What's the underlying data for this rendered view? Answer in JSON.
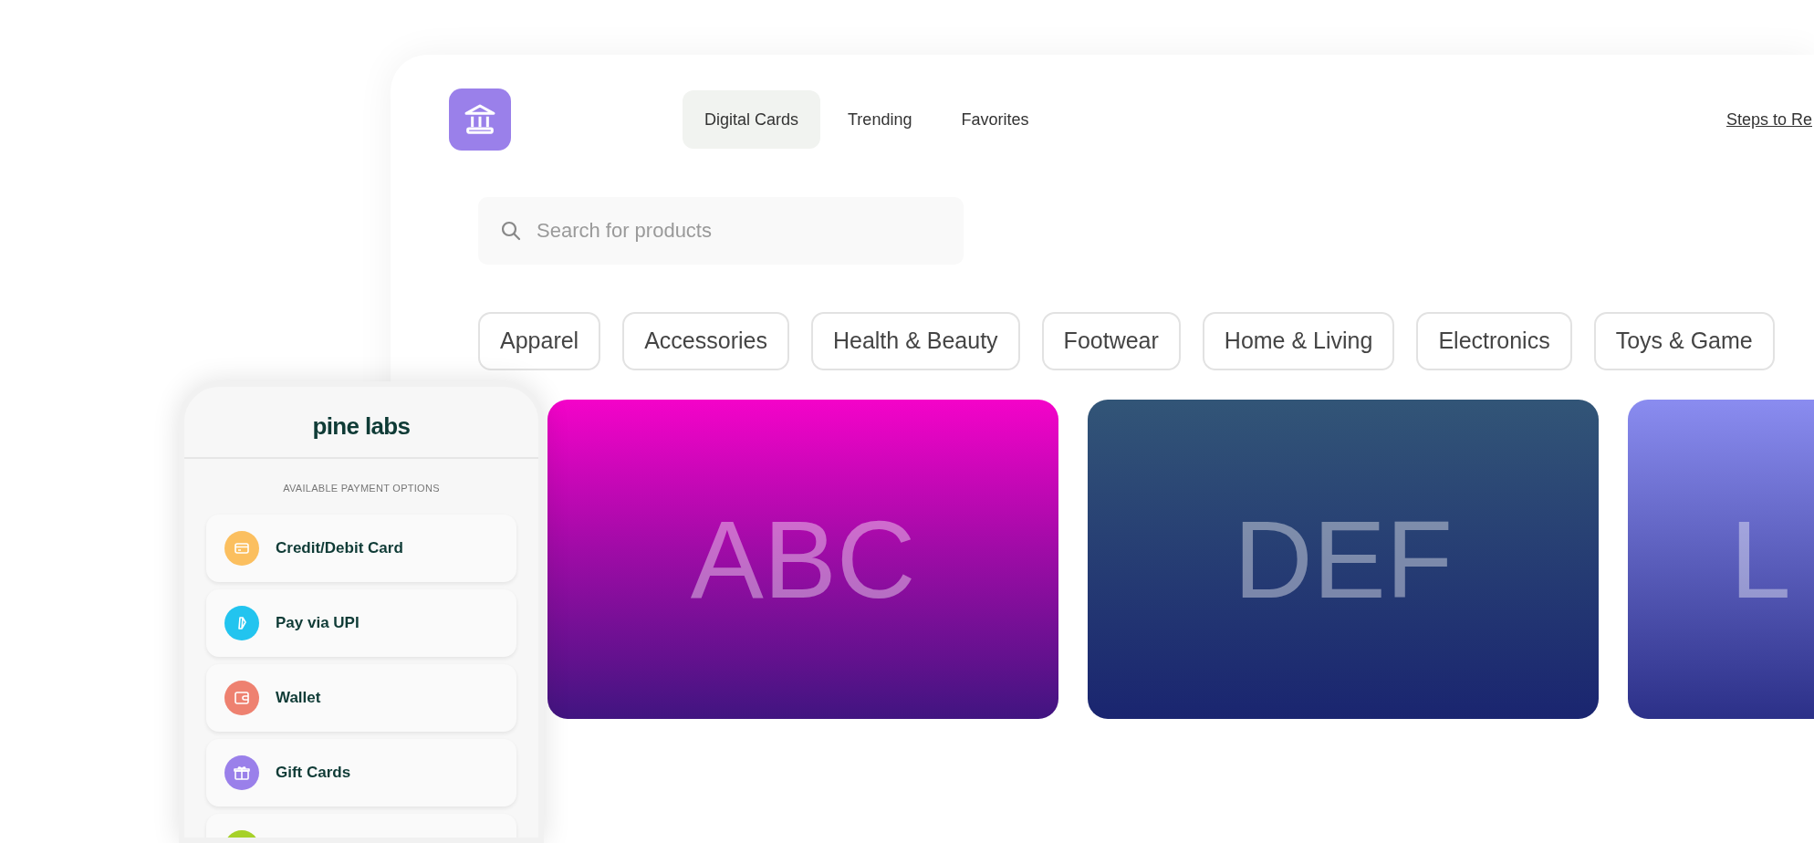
{
  "nav": {
    "tabs": [
      {
        "label": "Digital Cards",
        "selected": true
      },
      {
        "label": "Trending",
        "selected": false
      },
      {
        "label": "Favorites",
        "selected": false
      }
    ],
    "link": "Steps to Re"
  },
  "search": {
    "placeholder": "Search for products"
  },
  "categories": [
    "Apparel",
    "Accessories",
    "Health & Beauty",
    "Footwear",
    "Home & Living",
    "Electronics",
    "Toys & Game"
  ],
  "cards": [
    {
      "label": "ABC",
      "color": "#f403c9"
    },
    {
      "label": "DEF",
      "color": "#325577"
    },
    {
      "label": "L",
      "color": "#8a8cf0"
    }
  ],
  "checkout": {
    "brand": "pine labs",
    "heading": "AVAILABLE PAYMENT OPTIONS",
    "options": [
      {
        "kind": "card",
        "label": "Credit/Debit Card",
        "color": "#fbbf5f"
      },
      {
        "kind": "upi",
        "label": "Pay via UPI",
        "color": "#22c4ef"
      },
      {
        "kind": "wallet",
        "label": "Wallet",
        "color": "#ee8170"
      },
      {
        "kind": "gift",
        "label": "Gift Cards",
        "color": "#9a80ea"
      },
      {
        "kind": "other",
        "color": "#a6d129"
      }
    ]
  }
}
